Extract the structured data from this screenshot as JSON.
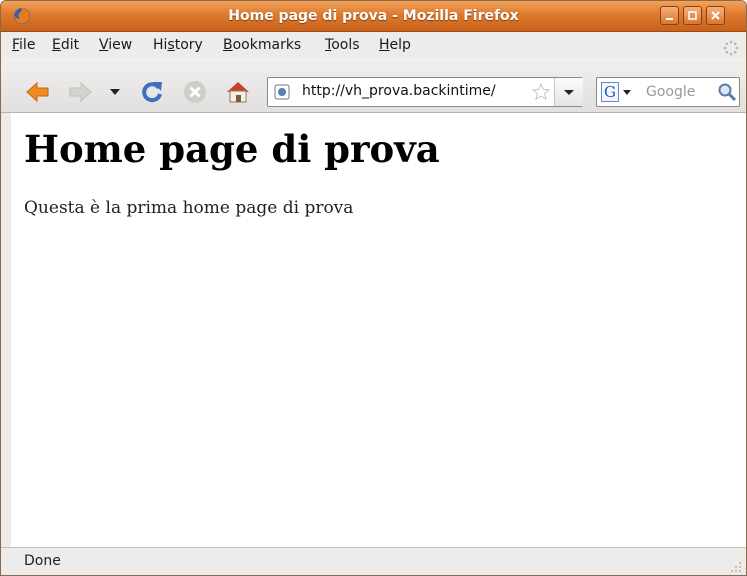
{
  "window": {
    "title": "Home page di prova - Mozilla Firefox"
  },
  "menu": [
    {
      "pre": "",
      "key": "F",
      "post": "ile"
    },
    {
      "pre": "",
      "key": "E",
      "post": "dit"
    },
    {
      "pre": "",
      "key": "V",
      "post": "iew"
    },
    {
      "pre": "Hi",
      "key": "s",
      "post": "tory"
    },
    {
      "pre": "",
      "key": "B",
      "post": "ookmarks"
    },
    {
      "pre": "",
      "key": "T",
      "post": "ools"
    },
    {
      "pre": "",
      "key": "H",
      "post": "elp"
    }
  ],
  "navigation": {
    "url": "http://vh_prova.backintime/",
    "search_engine_letter": "G",
    "search_placeholder": "Google"
  },
  "page": {
    "heading": "Home page di prova",
    "text": "Questa è la prima home page di prova"
  },
  "status": {
    "text": "Done"
  },
  "colors": {
    "title_bar": "#dd7a2e",
    "background": "#edeceb"
  }
}
